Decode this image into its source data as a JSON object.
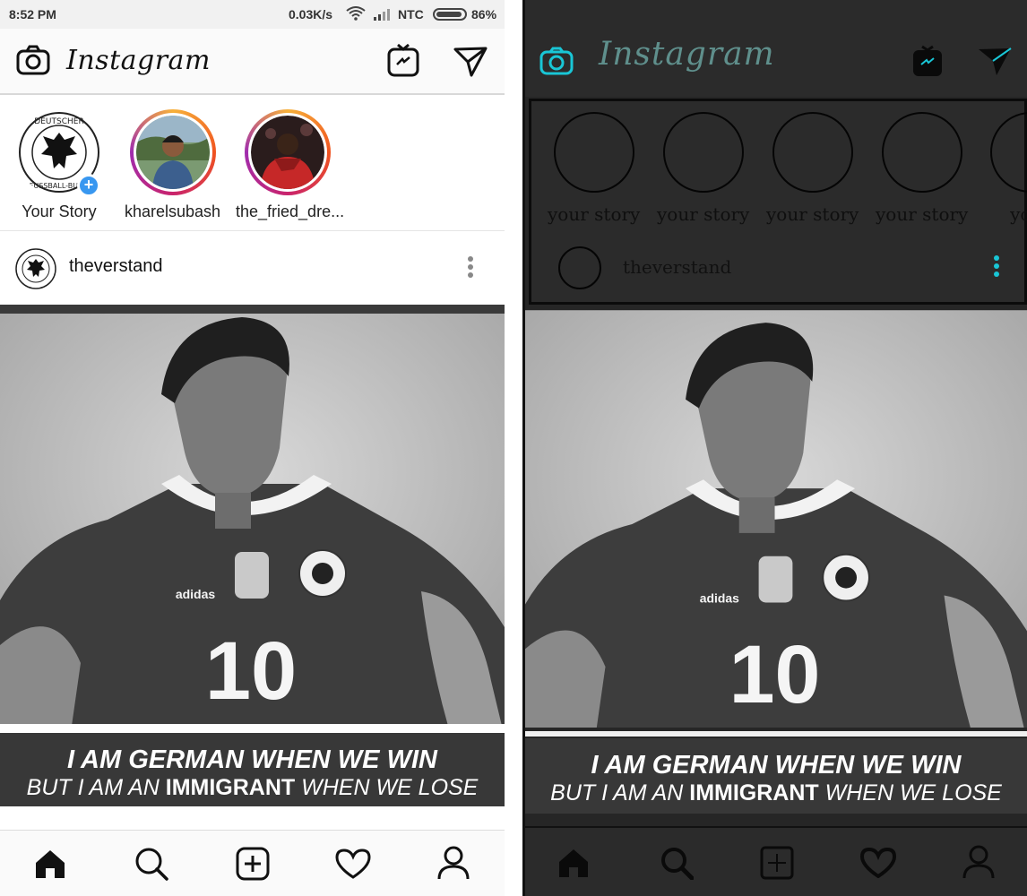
{
  "light": {
    "status": {
      "time": "8:52 PM",
      "speed": "0.03K/s",
      "carrier": "NTC",
      "battery": "86%"
    },
    "header": {
      "logo": "Instagram",
      "camera_icon": "camera-icon",
      "igtv_icon": "tv-icon",
      "direct_icon": "paper-plane-icon"
    },
    "stories": [
      {
        "label": "Your Story"
      },
      {
        "label": "kharelsubash"
      },
      {
        "label": "the_fried_dre..."
      }
    ],
    "post": {
      "username": "theverstand",
      "caption_line1": "I AM GERMAN WHEN WE WIN",
      "caption_line2_a": "BUT I AM AN ",
      "caption_line2_b": "IMMIGRANT",
      "caption_line2_c": " WHEN WE LOSE",
      "jersey_number": "10",
      "jersey_brand": "adidas"
    },
    "nav": [
      "home-icon",
      "search-icon",
      "add-icon",
      "heart-icon",
      "profile-icon"
    ]
  },
  "dark": {
    "header": {
      "logo": "Instagram"
    },
    "stories": [
      {
        "label": "your story"
      },
      {
        "label": "your story"
      },
      {
        "label": "your story"
      },
      {
        "label": "your story"
      },
      {
        "label": "your"
      }
    ],
    "post": {
      "username": "theverstand",
      "caption_line1": "I AM GERMAN WHEN WE WIN",
      "caption_line2_a": "BUT I AM AN ",
      "caption_line2_b": "IMMIGRANT",
      "caption_line2_c": " WHEN WE LOSE",
      "jersey_number": "10",
      "jersey_brand": "adidas"
    },
    "accent": "#19c6d6"
  }
}
